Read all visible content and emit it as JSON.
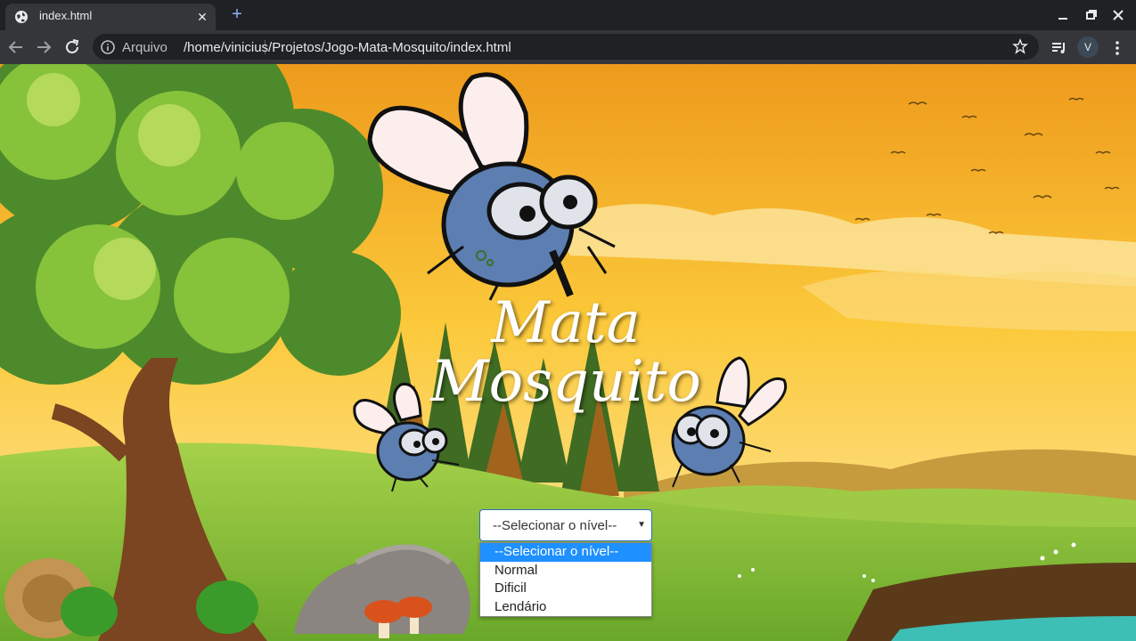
{
  "browser": {
    "tab_title": "index.html",
    "omnibox_scheme": "Arquivo",
    "omnibox_url": "/home/vinicius/Projetos/Jogo-Mata-Mosquito/index.html",
    "profile_initial": "V"
  },
  "game": {
    "title_line1": "Mata",
    "title_line2": "Mosquito"
  },
  "level_select": {
    "selected": "--Selecionar o nível--",
    "options": [
      "--Selecionar o nível--",
      "Normal",
      "Dificil",
      "Lendário"
    ]
  },
  "colors": {
    "sky_top": "#f2a21f",
    "sky_bottom": "#fbd76a",
    "grass": "#8cc63f",
    "select_highlight": "#1e90ff"
  }
}
